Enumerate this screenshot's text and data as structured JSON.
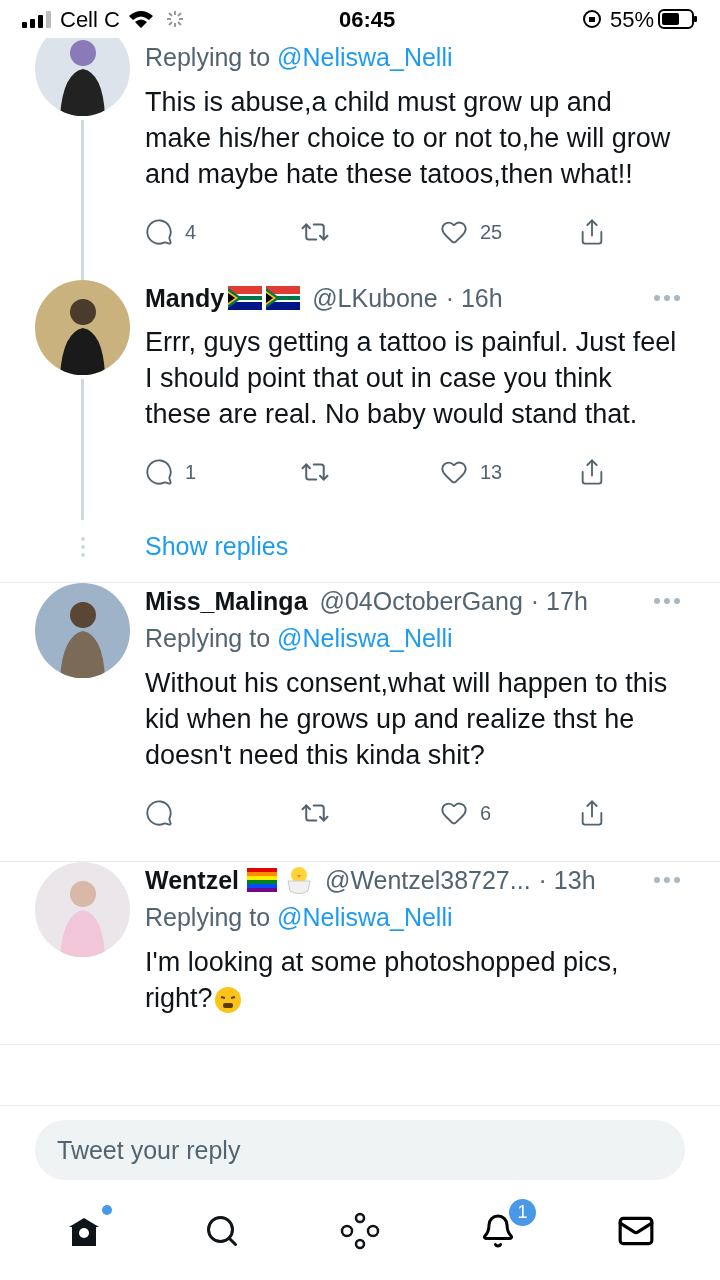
{
  "status_bar": {
    "carrier": "Cell C",
    "time": "06:45",
    "battery": "55%"
  },
  "tweets": [
    {
      "replying_label": "Replying to",
      "replying_to": "@Neliswa_Nelli",
      "text": "This is abuse,a child must grow up and make his/her choice to or not to,he will grow and maybe hate these tatoos,then what!!",
      "replies": "4",
      "likes": "25",
      "thread_below": true
    },
    {
      "header": {
        "name": "Mandy",
        "name_icons": [
          {
            "kind": "sa-flag"
          },
          {
            "kind": "sa-flag"
          }
        ],
        "handle": "@LKubone",
        "time": "· 16h"
      },
      "text": "Errr, guys getting a tattoo is painful. Just feel I should point that out in case you think these are real. No baby would stand that.",
      "replies": "1",
      "likes": "13",
      "thread_below": true,
      "show_replies": "Show replies"
    },
    {
      "header": {
        "name": "Miss_Malinga",
        "handle": "@04OctoberGang",
        "time": "· 17h"
      },
      "replying_label": "Replying to",
      "replying_to": "@Neliswa_Nelli",
      "text": "Without his consent,what will happen to this kid when he grows up and realize thst he doesn't need this kinda shit?",
      "likes": "6",
      "thread_below": false
    },
    {
      "header": {
        "name": "Wentzel",
        "name_icons": [
          {
            "kind": "rainbow-flag"
          },
          {
            "kind": "chick"
          }
        ],
        "handle": "@Wentzel38727...",
        "time": "· 13h"
      },
      "replying_label": "Replying to",
      "replying_to": "@Neliswa_Nelli",
      "text": "I'm looking at some photoshopped pics, right?",
      "text_icon": {
        "kind": "steam-face"
      },
      "thread_below": false,
      "actions_hidden": true
    }
  ],
  "reply_field": {
    "placeholder": "Tweet your reply"
  },
  "tabs": [
    {
      "kind": "home",
      "selected": true,
      "dot": true
    },
    {
      "kind": "search",
      "selected": false
    },
    {
      "kind": "spaces",
      "selected": false
    },
    {
      "kind": "notifications",
      "selected": false,
      "badge": "1"
    },
    {
      "kind": "messages",
      "selected": false
    }
  ]
}
